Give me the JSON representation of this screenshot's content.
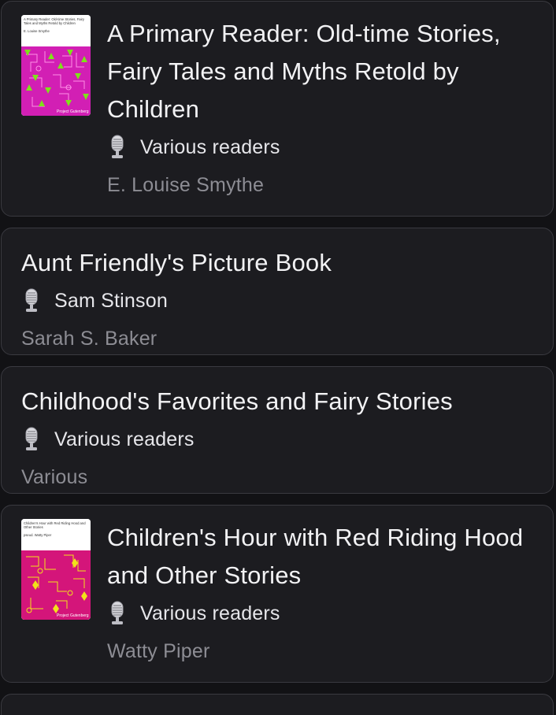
{
  "books": [
    {
      "title": "A Primary Reader: Old-time Stories, Fairy Tales and Myths Retold by Children",
      "narrator": "Various readers",
      "author": "E. Louise Smythe",
      "cover": {
        "has_cover": true,
        "cover_title": "A Primary Reader: Old-time Stories, Fairy Tales and Myths Retold by Children",
        "cover_author": "E. Louise Smythe",
        "publisher": "Project Gutenberg",
        "bg_color": "#d21fb4",
        "accent_color": "#7ee21a"
      }
    },
    {
      "title": "Aunt Friendly's Picture Book",
      "narrator": "Sam Stinson",
      "author": "Sarah S. Baker",
      "cover": {
        "has_cover": false
      }
    },
    {
      "title": "Childhood's Favorites and Fairy Stories",
      "narrator": "Various readers",
      "author": "Various",
      "cover": {
        "has_cover": false
      }
    },
    {
      "title": "Children's Hour with Red Riding Hood and Other Stories",
      "narrator": "Various readers",
      "author": "Watty Piper",
      "cover": {
        "has_cover": true,
        "cover_title": "Children's Hour with Red Riding Hood and Other Stories",
        "cover_author": "pseud. Watty Piper",
        "publisher": "Project Gutenberg",
        "bg_color": "#d4157a",
        "accent_color": "#f2e21a"
      }
    }
  ],
  "icons": {
    "narrator": "microphone-icon"
  }
}
